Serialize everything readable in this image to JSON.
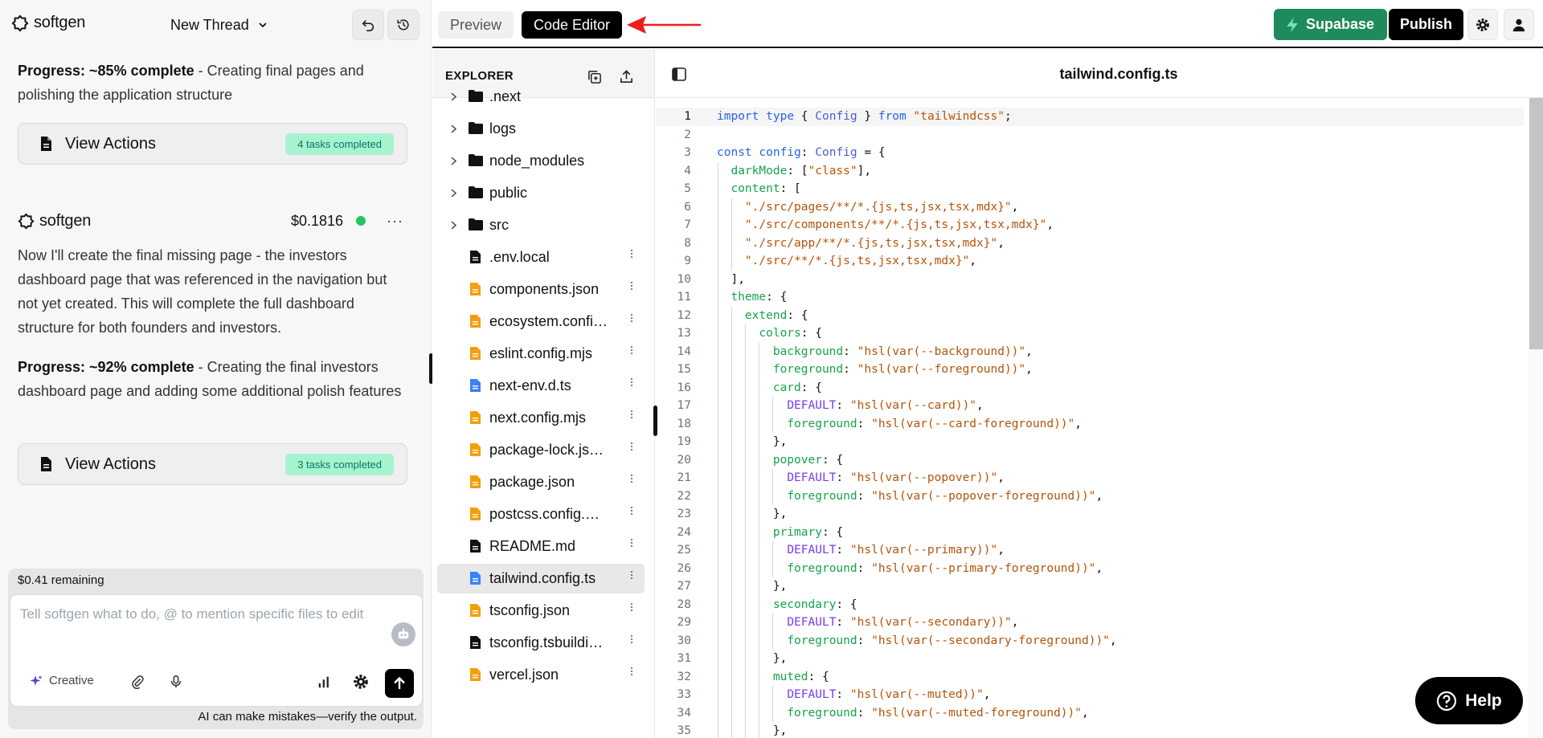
{
  "app": {
    "brand": "softgen",
    "thread_title": "New Thread"
  },
  "chat": {
    "messages": [
      {
        "progress_label": "Progress: ~85% complete",
        "progress_text": " - Creating final pages and polishing the application structure",
        "actions_label": "View Actions",
        "badge": "4 tasks completed"
      },
      {
        "author": "softgen",
        "price": "$0.1816",
        "body": "Now I'll create the final missing page - the investors dashboard page that was referenced in the navigation but not yet created. This will complete the full dashboard structure for both founders and investors.",
        "progress_label": "Progress: ~92% complete",
        "progress_text": " - Creating the final investors dashboard page and adding some additional polish features",
        "actions_label": "View Actions",
        "badge": "3 tasks completed"
      }
    ]
  },
  "composer": {
    "remaining": "$0.41 remaining",
    "placeholder": "Tell softgen what to do, @ to mention specific files to edit",
    "mode_label": "Creative",
    "disclaimer": "AI can make mistakes—verify the output."
  },
  "topbar": {
    "tabs": [
      {
        "label": "Preview"
      },
      {
        "label": "Code Editor",
        "active": true
      }
    ],
    "supabase_label": "Supabase",
    "publish_label": "Publish"
  },
  "explorer": {
    "title": "EXPLORER",
    "items": [
      {
        "name": ".next",
        "type": "folder"
      },
      {
        "name": "logs",
        "type": "folder"
      },
      {
        "name": "node_modules",
        "type": "folder"
      },
      {
        "name": "public",
        "type": "folder"
      },
      {
        "name": "src",
        "type": "folder"
      },
      {
        "name": ".env.local",
        "type": "file",
        "color": "#111111"
      },
      {
        "name": "components.json",
        "type": "file",
        "color": "#f59e0b"
      },
      {
        "name": "ecosystem.confi…",
        "type": "file",
        "color": "#f59e0b"
      },
      {
        "name": "eslint.config.mjs",
        "type": "file",
        "color": "#f59e0b"
      },
      {
        "name": "next-env.d.ts",
        "type": "file",
        "color": "#3b82f6"
      },
      {
        "name": "next.config.mjs",
        "type": "file",
        "color": "#f59e0b"
      },
      {
        "name": "package-lock.js…",
        "type": "file",
        "color": "#f59e0b"
      },
      {
        "name": "package.json",
        "type": "file",
        "color": "#f59e0b"
      },
      {
        "name": "postcss.config.…",
        "type": "file",
        "color": "#f59e0b"
      },
      {
        "name": "README.md",
        "type": "file",
        "color": "#111111"
      },
      {
        "name": "tailwind.config.ts",
        "type": "file",
        "color": "#3b82f6",
        "selected": true
      },
      {
        "name": "tsconfig.json",
        "type": "file",
        "color": "#f59e0b"
      },
      {
        "name": "tsconfig.tsbuildi…",
        "type": "file",
        "color": "#111111"
      },
      {
        "name": "vercel.json",
        "type": "file",
        "color": "#f59e0b"
      }
    ]
  },
  "editor": {
    "filename": "tailwind.config.ts",
    "current_line": 1,
    "lines": [
      [
        [
          "k",
          "import"
        ],
        [
          "p",
          " "
        ],
        [
          "k",
          "type"
        ],
        [
          "p",
          " { "
        ],
        [
          "t",
          "Config"
        ],
        [
          "p",
          " } "
        ],
        [
          "k",
          "from"
        ],
        [
          "p",
          " "
        ],
        [
          "s",
          "\"tailwindcss\""
        ],
        [
          "p",
          ";"
        ]
      ],
      [],
      [
        [
          "k",
          "const"
        ],
        [
          "p",
          " "
        ],
        [
          "pr2",
          "config"
        ],
        [
          "p",
          ": "
        ],
        [
          "t",
          "Config"
        ],
        [
          "p",
          " = {"
        ]
      ],
      [
        [
          "p",
          "  "
        ],
        [
          "pr",
          "darkMode"
        ],
        [
          "p",
          ": ["
        ],
        [
          "s",
          "\"class\""
        ],
        [
          "p",
          "],"
        ]
      ],
      [
        [
          "p",
          "  "
        ],
        [
          "pr",
          "content"
        ],
        [
          "p",
          ": ["
        ]
      ],
      [
        [
          "p",
          "    "
        ],
        [
          "s",
          "\"./src/pages/**/*.{js,ts,jsx,tsx,mdx}\""
        ],
        [
          "p",
          ","
        ]
      ],
      [
        [
          "p",
          "    "
        ],
        [
          "s",
          "\"./src/components/**/*.{js,ts,jsx,tsx,mdx}\""
        ],
        [
          "p",
          ","
        ]
      ],
      [
        [
          "p",
          "    "
        ],
        [
          "s",
          "\"./src/app/**/*.{js,ts,jsx,tsx,mdx}\""
        ],
        [
          "p",
          ","
        ]
      ],
      [
        [
          "p",
          "    "
        ],
        [
          "s",
          "\"./src/**/*.{js,ts,jsx,tsx,mdx}\""
        ],
        [
          "p",
          ","
        ]
      ],
      [
        [
          "p",
          "  ],"
        ]
      ],
      [
        [
          "p",
          "  "
        ],
        [
          "pr",
          "theme"
        ],
        [
          "p",
          ": {"
        ]
      ],
      [
        [
          "p",
          "    "
        ],
        [
          "pr",
          "extend"
        ],
        [
          "p",
          ": {"
        ]
      ],
      [
        [
          "p",
          "      "
        ],
        [
          "pr",
          "colors"
        ],
        [
          "p",
          ": {"
        ]
      ],
      [
        [
          "p",
          "        "
        ],
        [
          "pr",
          "background"
        ],
        [
          "p",
          ": "
        ],
        [
          "s",
          "\"hsl(var(--background))\""
        ],
        [
          "p",
          ","
        ]
      ],
      [
        [
          "p",
          "        "
        ],
        [
          "pr",
          "foreground"
        ],
        [
          "p",
          ": "
        ],
        [
          "s",
          "\"hsl(var(--foreground))\""
        ],
        [
          "p",
          ","
        ]
      ],
      [
        [
          "p",
          "        "
        ],
        [
          "pr",
          "card"
        ],
        [
          "p",
          ": {"
        ]
      ],
      [
        [
          "p",
          "          "
        ],
        [
          "pr3",
          "DEFAULT"
        ],
        [
          "p",
          ": "
        ],
        [
          "s",
          "\"hsl(var(--card))\""
        ],
        [
          "p",
          ","
        ]
      ],
      [
        [
          "p",
          "          "
        ],
        [
          "pr",
          "foreground"
        ],
        [
          "p",
          ": "
        ],
        [
          "s",
          "\"hsl(var(--card-foreground))\""
        ],
        [
          "p",
          ","
        ]
      ],
      [
        [
          "p",
          "        },"
        ]
      ],
      [
        [
          "p",
          "        "
        ],
        [
          "pr",
          "popover"
        ],
        [
          "p",
          ": {"
        ]
      ],
      [
        [
          "p",
          "          "
        ],
        [
          "pr3",
          "DEFAULT"
        ],
        [
          "p",
          ": "
        ],
        [
          "s",
          "\"hsl(var(--popover))\""
        ],
        [
          "p",
          ","
        ]
      ],
      [
        [
          "p",
          "          "
        ],
        [
          "pr",
          "foreground"
        ],
        [
          "p",
          ": "
        ],
        [
          "s",
          "\"hsl(var(--popover-foreground))\""
        ],
        [
          "p",
          ","
        ]
      ],
      [
        [
          "p",
          "        },"
        ]
      ],
      [
        [
          "p",
          "        "
        ],
        [
          "pr",
          "primary"
        ],
        [
          "p",
          ": {"
        ]
      ],
      [
        [
          "p",
          "          "
        ],
        [
          "pr3",
          "DEFAULT"
        ],
        [
          "p",
          ": "
        ],
        [
          "s",
          "\"hsl(var(--primary))\""
        ],
        [
          "p",
          ","
        ]
      ],
      [
        [
          "p",
          "          "
        ],
        [
          "pr",
          "foreground"
        ],
        [
          "p",
          ": "
        ],
        [
          "s",
          "\"hsl(var(--primary-foreground))\""
        ],
        [
          "p",
          ","
        ]
      ],
      [
        [
          "p",
          "        },"
        ]
      ],
      [
        [
          "p",
          "        "
        ],
        [
          "pr",
          "secondary"
        ],
        [
          "p",
          ": {"
        ]
      ],
      [
        [
          "p",
          "          "
        ],
        [
          "pr3",
          "DEFAULT"
        ],
        [
          "p",
          ": "
        ],
        [
          "s",
          "\"hsl(var(--secondary))\""
        ],
        [
          "p",
          ","
        ]
      ],
      [
        [
          "p",
          "          "
        ],
        [
          "pr",
          "foreground"
        ],
        [
          "p",
          ": "
        ],
        [
          "s",
          "\"hsl(var(--secondary-foreground))\""
        ],
        [
          "p",
          ","
        ]
      ],
      [
        [
          "p",
          "        },"
        ]
      ],
      [
        [
          "p",
          "        "
        ],
        [
          "pr",
          "muted"
        ],
        [
          "p",
          ": {"
        ]
      ],
      [
        [
          "p",
          "          "
        ],
        [
          "pr3",
          "DEFAULT"
        ],
        [
          "p",
          ": "
        ],
        [
          "s",
          "\"hsl(var(--muted))\""
        ],
        [
          "p",
          ","
        ]
      ],
      [
        [
          "p",
          "          "
        ],
        [
          "pr",
          "foreground"
        ],
        [
          "p",
          ": "
        ],
        [
          "s",
          "\"hsl(var(--muted-foreground))\""
        ],
        [
          "p",
          ","
        ]
      ],
      [
        [
          "p",
          "        },"
        ]
      ]
    ]
  },
  "help": {
    "label": "Help"
  },
  "colors": {
    "supabase": "#1f8a5b",
    "badge_bg": "#a7f3d0",
    "badge_text": "#047857",
    "status_green": "#22c55e"
  },
  "icons": [
    "softgen-logo-icon",
    "chevron-down-icon",
    "undo-icon",
    "history-icon",
    "file-icon",
    "sparkle-icon",
    "paperclip-icon",
    "microphone-icon",
    "chart-icon",
    "gear-icon",
    "arrow-up-icon",
    "bot-icon",
    "bolt-icon",
    "user-icon",
    "copy-icon",
    "upload-icon",
    "folder-icon",
    "chevron-right-icon",
    "sidebar-icon",
    "help-icon"
  ]
}
